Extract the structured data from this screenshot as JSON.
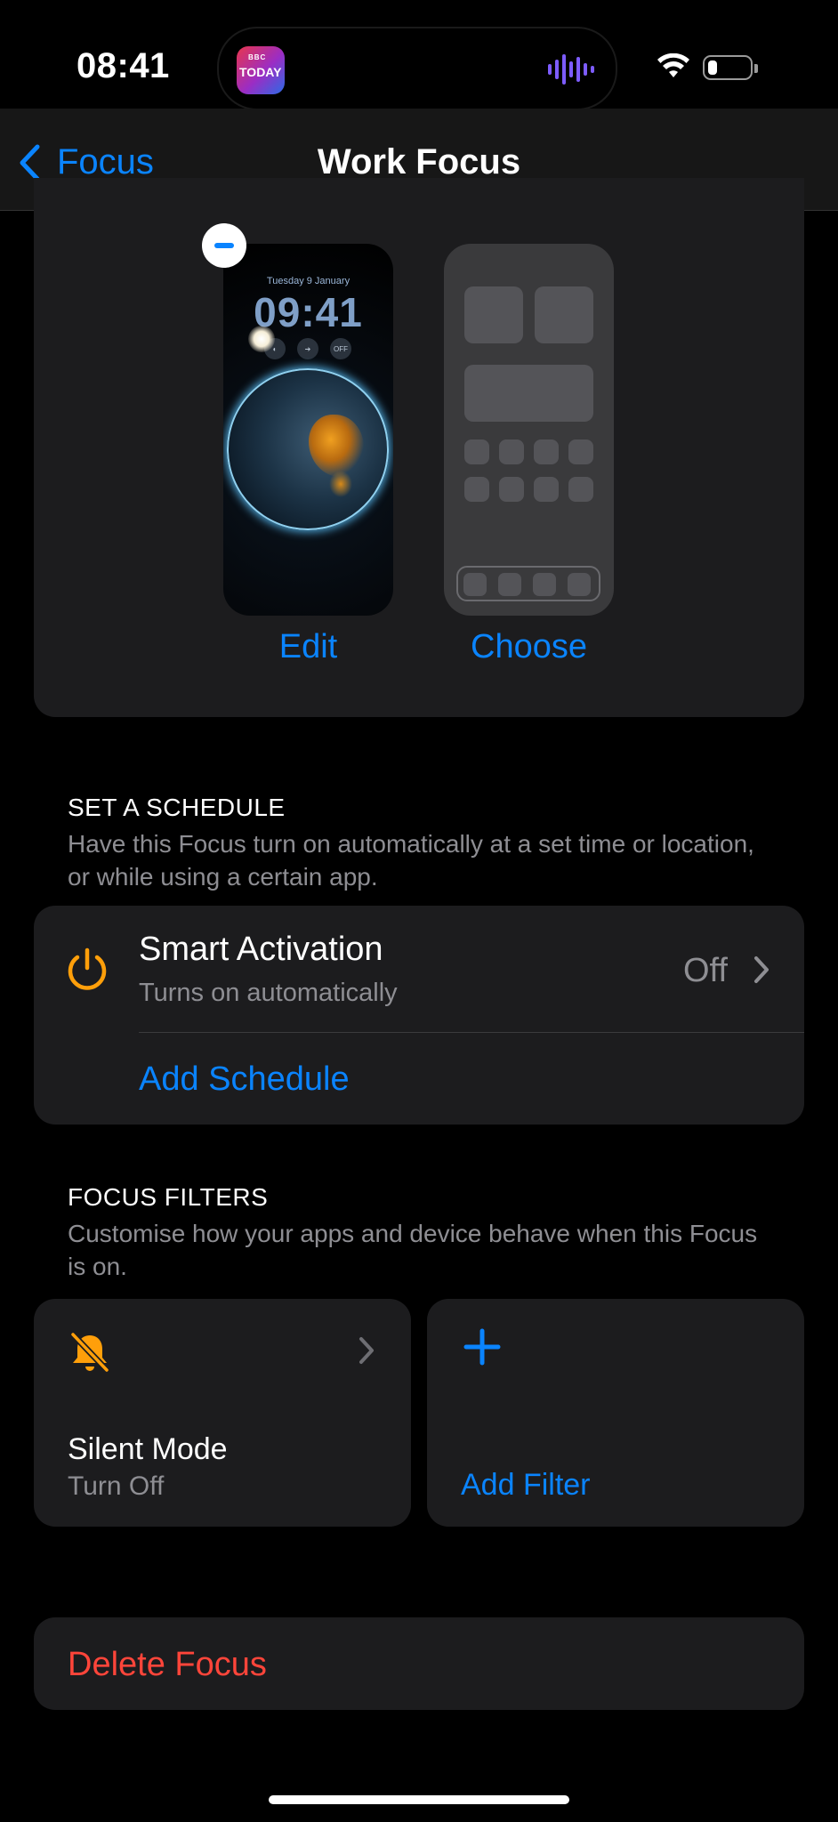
{
  "status_bar": {
    "time": "08:41",
    "live_activity_app": {
      "line1": "BBC",
      "line2": "TODAY"
    },
    "battery_level_percent": 15
  },
  "nav": {
    "back_label": "Focus",
    "title": "Work Focus"
  },
  "wallpaper": {
    "lock_date": "Tuesday 9 January",
    "lock_time": "09:41",
    "lock_widget_off": "OFF",
    "edit_label": "Edit",
    "choose_label": "Choose"
  },
  "schedule": {
    "header": "SET A SCHEDULE",
    "description": "Have this Focus turn on automatically at a set time or location, or while using a certain app.",
    "smart_activation": {
      "title": "Smart Activation",
      "subtitle": "Turns on automatically",
      "value": "Off"
    },
    "add_schedule_label": "Add Schedule"
  },
  "filters": {
    "header": "FOCUS FILTERS",
    "description": "Customise how your apps and device behave when this Focus is on.",
    "silent_mode": {
      "title": "Silent Mode",
      "subtitle": "Turn Off"
    },
    "add_filter_label": "Add Filter"
  },
  "delete_label": "Delete Focus",
  "colors": {
    "accent": "#0a84ff",
    "destructive": "#ff453a",
    "icon_orange": "#ff9f0a",
    "card_bg": "#1c1c1e"
  },
  "icons": [
    "chevron-left-icon",
    "power-icon",
    "chevron-right-icon",
    "bell-slash-icon",
    "plus-icon",
    "wifi-icon",
    "battery-icon",
    "waveform-icon",
    "minus-icon"
  ]
}
